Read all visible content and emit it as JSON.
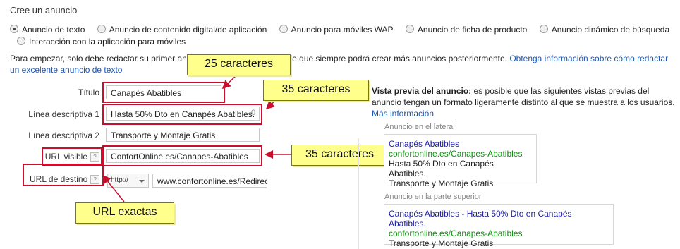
{
  "page": {
    "title": "Cree un anuncio"
  },
  "ad_types": [
    {
      "label": "Anuncio de texto",
      "selected": true
    },
    {
      "label": "Anuncio de contenido digital/de aplicación",
      "selected": false
    },
    {
      "label": "Anuncio para móviles WAP",
      "selected": false
    },
    {
      "label": "Anuncio de ficha de producto",
      "selected": false
    },
    {
      "label": "Anuncio dinámico de búsqueda",
      "selected": false
    },
    {
      "label": "Interacción con la aplicación para móviles",
      "selected": false
    }
  ],
  "intro": {
    "text_a": "Para empezar, solo debe redactar su primer an",
    "text_b": "erde que siempre podrá crear más anuncios posteriormente. ",
    "link": "Obtenga información sobre cómo redactar un excelente anuncio de texto"
  },
  "form": {
    "titulo": {
      "label": "Título",
      "value": "Canapés Abatibles"
    },
    "linea1": {
      "label": "Línea descriptiva 1",
      "value": "Hasta 50% Dto en Canapés Abatibles.",
      "count": "0"
    },
    "linea2": {
      "label": "Línea descriptiva 2",
      "value": "Transporte y Montaje Gratis"
    },
    "url_visible": {
      "label": "URL visible",
      "value": "ConfortOnline.es/Canapes-Abatibles"
    },
    "url_destino": {
      "label": "URL de destino",
      "protocol": "http://",
      "value": "www.confortonline.es/Redirect"
    },
    "help": "?"
  },
  "callouts": {
    "c1": "25 caracteres",
    "c2": "35 caracteres",
    "c3": "35 caracteres",
    "c4": "URL exactas"
  },
  "preview": {
    "heading": "Vista previa del anuncio:",
    "heading_rest": " es posible que las siguientes vistas previas del anuncio tengan un formato ligeramente distinto al que se muestra a los usuarios. ",
    "more_link": "Más información",
    "side": {
      "label": "Anuncio en el lateral",
      "title": "Canapés Abatibles",
      "url": "confortonline.es/Canapes-Abatibles",
      "line1": "Hasta 50% Dto en Canapés Abatibles.",
      "line2": "Transporte y Montaje Gratis"
    },
    "top": {
      "label": "Anuncio en la parte superior",
      "title": "Canapés Abatibles - Hasta 50% Dto en Canapés Abatibles.",
      "url": "confortonline.es/Canapes-Abatibles",
      "line1": "Transporte y Montaje Gratis"
    }
  },
  "colors": {
    "accent_red": "#c8102e",
    "callout_yellow": "#ffff8c",
    "link_blue": "#1a56b8",
    "ad_title": "#1a1aa6",
    "ad_url": "#138d13"
  }
}
